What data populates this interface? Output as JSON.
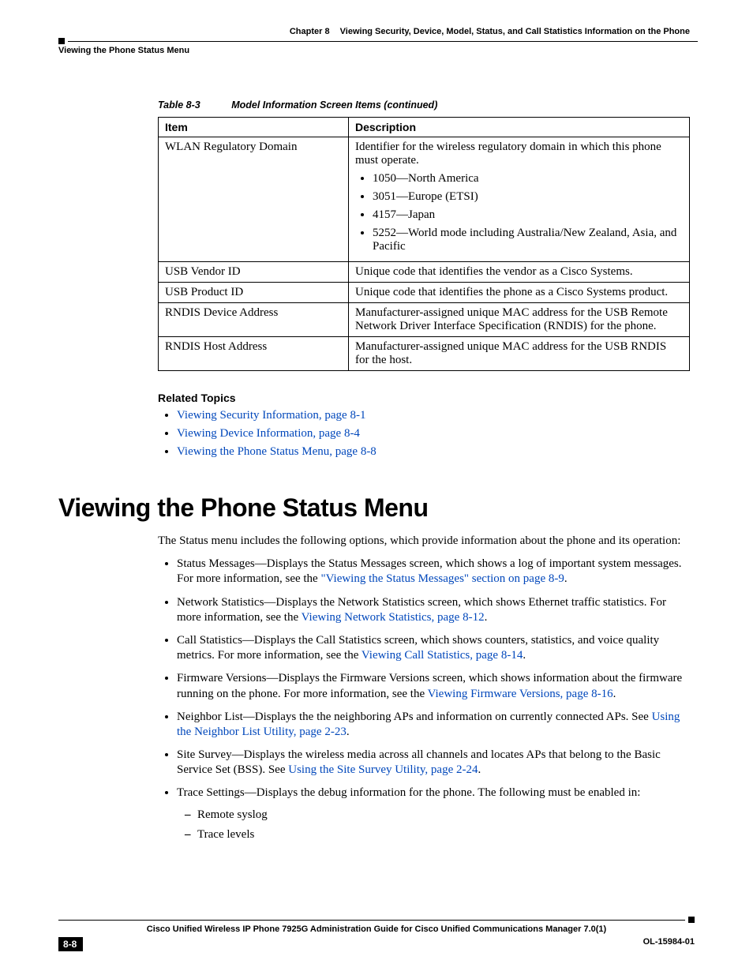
{
  "header": {
    "chapter_label": "Chapter 8",
    "chapter_title": "Viewing Security, Device, Model, Status, and Call Statistics Information on the Phone",
    "section_title": "Viewing the Phone Status Menu"
  },
  "table": {
    "caption_num": "Table 8-3",
    "caption_title": "Model Information Screen Items (continued)",
    "head_item": "Item",
    "head_desc": "Description",
    "rows": {
      "r0": {
        "item": "WLAN Regulatory Domain",
        "desc_intro": "Identifier for the wireless regulatory domain in which this phone must operate.",
        "bullets": {
          "b0": "1050—North America",
          "b1": "3051—Europe (ETSI)",
          "b2": "4157—Japan",
          "b3": "5252—World mode including Australia/New Zealand, Asia, and Pacific"
        }
      },
      "r1": {
        "item": "USB Vendor ID",
        "desc": "Unique code that identifies the vendor as a Cisco Systems."
      },
      "r2": {
        "item": "USB Product ID",
        "desc": "Unique code that identifies the phone as a Cisco Systems product."
      },
      "r3": {
        "item": "RNDIS Device Address",
        "desc": "Manufacturer-assigned unique MAC address for the USB Remote Network Driver Interface Specification (RNDIS) for the phone."
      },
      "r4": {
        "item": "RNDIS Host Address",
        "desc": "Manufacturer-assigned unique MAC address for the USB RNDIS for the host."
      }
    }
  },
  "related": {
    "heading": "Related Topics",
    "items": {
      "i0": "Viewing Security Information, page 8-1",
      "i1": "Viewing Device Information, page 8-4",
      "i2": "Viewing the Phone Status Menu, page 8-8"
    }
  },
  "section": {
    "title": "Viewing the Phone Status Menu",
    "intro": "The Status menu includes the following options, which provide information about the phone and its operation:",
    "items": {
      "i0": {
        "pre": "Status Messages—Displays the Status Messages screen, which shows a log of important system messages. For more information, see the ",
        "link": "\"Viewing the Status Messages\" section on page 8-9",
        "post": "."
      },
      "i1": {
        "pre": "Network Statistics—Displays the Network Statistics screen, which shows Ethernet traffic statistics. For more information, see the ",
        "link": "Viewing Network Statistics, page 8-12",
        "post": "."
      },
      "i2": {
        "pre": "Call Statistics—Displays the Call Statistics screen, which shows counters, statistics, and voice quality metrics. For more information, see the ",
        "link": "Viewing Call Statistics, page 8-14",
        "post": "."
      },
      "i3": {
        "pre": "Firmware Versions—Displays the Firmware Versions screen, which shows information about the firmware running on the phone. For more information, see the ",
        "link": "Viewing Firmware Versions, page 8-16",
        "post": "."
      },
      "i4": {
        "pre": "Neighbor List—Displays the the neighboring APs and information on currently connected APs. See ",
        "link": "Using the Neighbor List Utility, page 2-23",
        "post": "."
      },
      "i5": {
        "pre": "Site Survey—Displays the wireless media across all channels and locates APs that belong to the Basic Service Set (BSS). See ",
        "link": "Using the Site Survey Utility, page 2-24",
        "post": "."
      },
      "i6": {
        "text": "Trace Settings—Displays the debug information for the phone. The following must be enabled in:",
        "sub": {
          "s0": "Remote syslog",
          "s1": "Trace levels"
        }
      }
    }
  },
  "footer": {
    "booktitle": "Cisco Unified Wireless IP Phone 7925G Administration Guide for Cisco Unified Communications Manager 7.0(1)",
    "pagenum": "8-8",
    "docnum": "OL-15984-01"
  }
}
